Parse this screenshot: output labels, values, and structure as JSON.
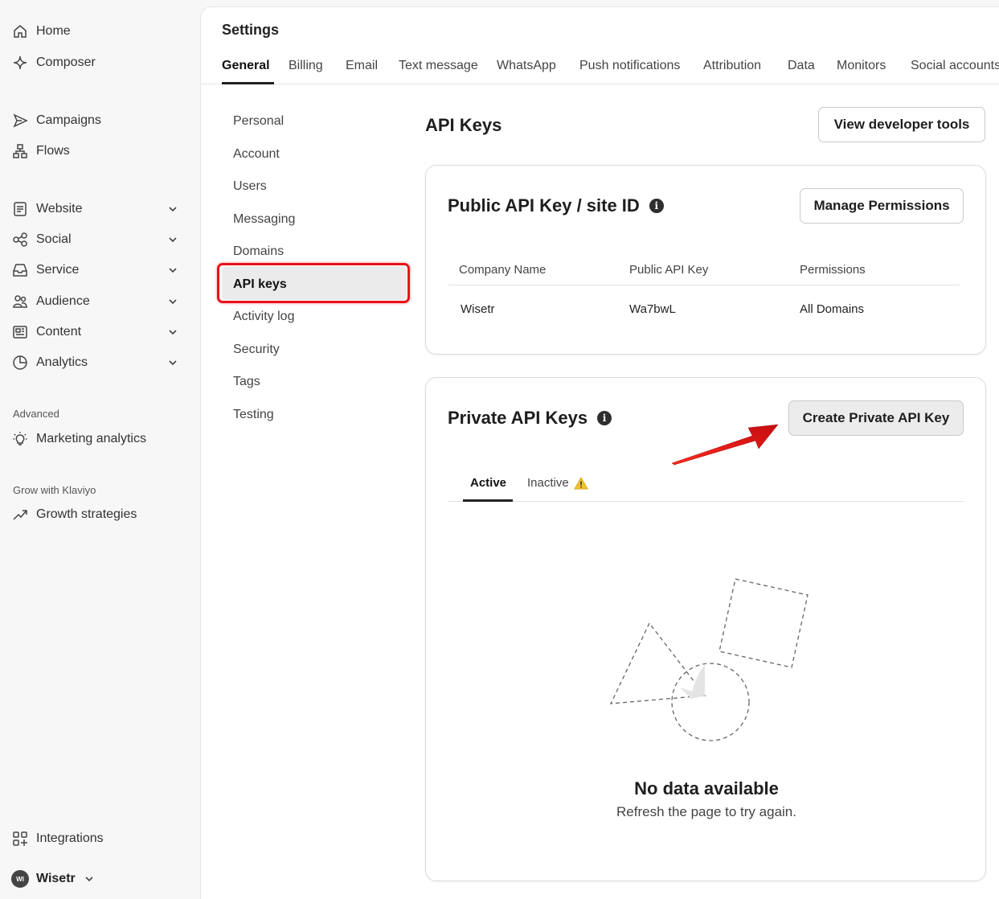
{
  "sidebar": {
    "home": "Home",
    "composer": "Composer",
    "campaigns": "Campaigns",
    "flows": "Flows",
    "website": "Website",
    "social": "Social",
    "service": "Service",
    "audience": "Audience",
    "content": "Content",
    "analytics": "Analytics",
    "advanced_label": "Advanced",
    "marketing_analytics": "Marketing analytics",
    "grow_label": "Grow with Klaviyo",
    "growth_strategies": "Growth strategies",
    "integrations": "Integrations",
    "account_initials": "WI",
    "account_name": "Wisetr"
  },
  "settings": {
    "title": "Settings",
    "tabs": [
      "General",
      "Billing",
      "Email",
      "Text message",
      "WhatsApp",
      "Push notifications",
      "Attribution",
      "Data",
      "Monitors",
      "Social accounts"
    ],
    "active_tab": "General"
  },
  "subnav": {
    "items": [
      "Personal",
      "Account",
      "Users",
      "Messaging",
      "Domains",
      "API keys",
      "Activity log",
      "Security",
      "Tags",
      "Testing"
    ],
    "active": "API keys"
  },
  "page": {
    "heading": "API Keys",
    "dev_tools_button": "View developer tools"
  },
  "public_card": {
    "title": "Public API Key / site ID",
    "info_glyph": "i",
    "manage_button": "Manage Permissions",
    "columns": [
      "Company Name",
      "Public API Key",
      "Permissions"
    ],
    "row": [
      "Wisetr",
      "Wa7bwL",
      "All Domains"
    ]
  },
  "private_card": {
    "title": "Private API Keys",
    "info_glyph": "i",
    "create_button": "Create Private API Key",
    "tabs": [
      "Active",
      "Inactive"
    ],
    "active_tab": "Active",
    "empty_title": "No data available",
    "empty_sub": "Refresh the page to try again."
  },
  "colors": {
    "highlight": "#e8131a",
    "warning": "#f2c230"
  }
}
